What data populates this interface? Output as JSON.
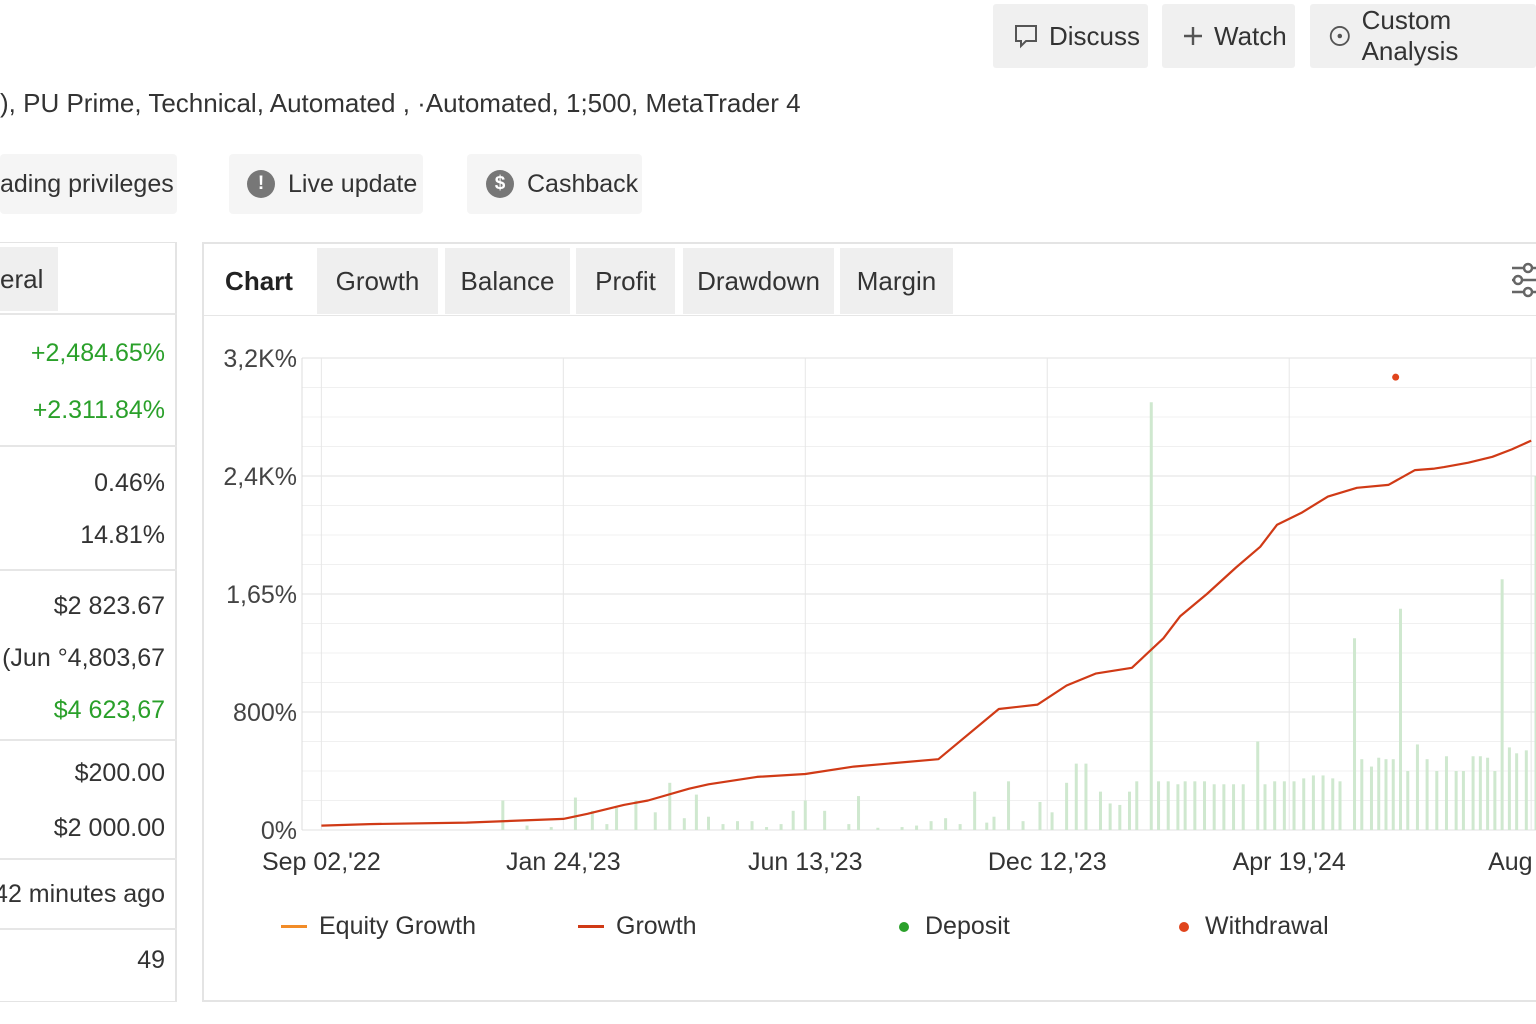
{
  "header": {
    "buttons": [
      {
        "label": "Discuss",
        "icon": "comment-icon"
      },
      {
        "label": "Watch",
        "icon": "plus-icon"
      },
      {
        "label": "Custom Analysis",
        "icon": "target-icon"
      }
    ],
    "meta": "), PU Prime, Technical, Automated , ·Automated, 1;500, MetaTrader 4"
  },
  "pills": {
    "privileges": "ading privileges",
    "live_update": "Live update",
    "live_update_icon": "!",
    "cashback": "Cashback",
    "cashback_icon": "$"
  },
  "stats": {
    "tab_label": "eral",
    "gain": "+2,484.65%",
    "abs_gain": "+2.311.84%",
    "daily": "0.46%",
    "drawdown": "14.81%",
    "balance": "$2 823.67",
    "equity": "(Jun °4,803,67",
    "profit": "$4 623,67",
    "deposits": "$200.00",
    "withdrawals": "$2 000.00",
    "updated": "42 minutes ago",
    "tracking": "49"
  },
  "tabs": [
    {
      "label": "Chart",
      "active": true
    },
    {
      "label": "Growth",
      "active": false
    },
    {
      "label": "Balance",
      "active": false
    },
    {
      "label": "Profit",
      "active": false
    },
    {
      "label": "Drawdown",
      "active": false
    },
    {
      "label": "Margin",
      "active": false
    }
  ],
  "colors": {
    "growth": "#d03a16",
    "equity": "#f28c28",
    "deposit": "#2aa02a",
    "withdrawal": "#e0441c",
    "bars": "#cfe8cf"
  },
  "chart_data": {
    "type": "line",
    "y_tick_labels": [
      "0%",
      "800%",
      "1,65%",
      "2,4K%",
      "3,2K%"
    ],
    "y_tick_values": [
      0,
      800,
      1600,
      2400,
      3200
    ],
    "x_tick_labels": [
      "Sep 02,'22",
      "Jan 24,'23",
      "Jun 13,'23",
      "Dec 12,'23",
      "Apr 19,'24",
      "Aug 05,"
    ],
    "x_range": [
      -0.08,
      5.02
    ],
    "ylim": [
      0,
      3200
    ],
    "grid": true,
    "series": [
      {
        "name": "Growth",
        "x": [
          0,
          0.2,
          0.6,
          1.0,
          1.1,
          1.25,
          1.35,
          1.52,
          1.6,
          1.8,
          2.0,
          2.2,
          2.55,
          2.8,
          2.96,
          3.08,
          3.2,
          3.35,
          3.48,
          3.55,
          3.66,
          3.78,
          3.88,
          3.95,
          4.05,
          4.16,
          4.28,
          4.41,
          4.52,
          4.6,
          4.64,
          4.74,
          4.84,
          4.92,
          5.0
        ],
        "y": [
          30,
          40,
          50,
          75,
          110,
          170,
          200,
          280,
          310,
          360,
          380,
          430,
          480,
          820,
          850,
          980,
          1060,
          1100,
          1300,
          1450,
          1600,
          1780,
          1920,
          2070,
          2150,
          2260,
          2320,
          2340,
          2440,
          2450,
          2460,
          2490,
          2530,
          2580,
          2640
        ]
      }
    ],
    "deposit_bars": [
      {
        "x": 0.75,
        "y": 200
      },
      {
        "x": 0.85,
        "y": 30
      },
      {
        "x": 0.95,
        "y": 20
      },
      {
        "x": 1.05,
        "y": 220
      },
      {
        "x": 1.12,
        "y": 130
      },
      {
        "x": 1.18,
        "y": 40
      },
      {
        "x": 1.22,
        "y": 150
      },
      {
        "x": 1.3,
        "y": 200
      },
      {
        "x": 1.38,
        "y": 120
      },
      {
        "x": 1.44,
        "y": 320
      },
      {
        "x": 1.5,
        "y": 80
      },
      {
        "x": 1.55,
        "y": 240
      },
      {
        "x": 1.6,
        "y": 90
      },
      {
        "x": 1.66,
        "y": 40
      },
      {
        "x": 1.72,
        "y": 60
      },
      {
        "x": 1.78,
        "y": 60
      },
      {
        "x": 1.84,
        "y": 20
      },
      {
        "x": 1.9,
        "y": 40
      },
      {
        "x": 1.95,
        "y": 130
      },
      {
        "x": 2.0,
        "y": 200
      },
      {
        "x": 2.08,
        "y": 130
      },
      {
        "x": 2.18,
        "y": 40
      },
      {
        "x": 2.22,
        "y": 230
      },
      {
        "x": 2.3,
        "y": 15
      },
      {
        "x": 2.4,
        "y": 20
      },
      {
        "x": 2.46,
        "y": 30
      },
      {
        "x": 2.52,
        "y": 60
      },
      {
        "x": 2.58,
        "y": 80
      },
      {
        "x": 2.64,
        "y": 40
      },
      {
        "x": 2.7,
        "y": 260
      },
      {
        "x": 2.75,
        "y": 50
      },
      {
        "x": 2.78,
        "y": 90
      },
      {
        "x": 2.84,
        "y": 330
      },
      {
        "x": 2.9,
        "y": 60
      },
      {
        "x": 2.97,
        "y": 190
      },
      {
        "x": 3.02,
        "y": 120
      },
      {
        "x": 3.08,
        "y": 320
      },
      {
        "x": 3.12,
        "y": 450
      },
      {
        "x": 3.16,
        "y": 450
      },
      {
        "x": 3.22,
        "y": 260
      },
      {
        "x": 3.26,
        "y": 180
      },
      {
        "x": 3.3,
        "y": 170
      },
      {
        "x": 3.34,
        "y": 260
      },
      {
        "x": 3.37,
        "y": 330
      },
      {
        "x": 3.43,
        "y": 2900
      },
      {
        "x": 3.46,
        "y": 330
      },
      {
        "x": 3.5,
        "y": 330
      },
      {
        "x": 3.54,
        "y": 310
      },
      {
        "x": 3.57,
        "y": 330
      },
      {
        "x": 3.61,
        "y": 330
      },
      {
        "x": 3.65,
        "y": 330
      },
      {
        "x": 3.69,
        "y": 310
      },
      {
        "x": 3.73,
        "y": 310
      },
      {
        "x": 3.77,
        "y": 310
      },
      {
        "x": 3.81,
        "y": 310
      },
      {
        "x": 3.87,
        "y": 600
      },
      {
        "x": 3.9,
        "y": 310
      },
      {
        "x": 3.94,
        "y": 330
      },
      {
        "x": 3.98,
        "y": 330
      },
      {
        "x": 4.02,
        "y": 330
      },
      {
        "x": 4.06,
        "y": 350
      },
      {
        "x": 4.1,
        "y": 370
      },
      {
        "x": 4.14,
        "y": 370
      },
      {
        "x": 4.18,
        "y": 350
      },
      {
        "x": 4.21,
        "y": 330
      },
      {
        "x": 4.27,
        "y": 1300
      },
      {
        "x": 4.3,
        "y": 480
      },
      {
        "x": 4.34,
        "y": 430
      },
      {
        "x": 4.37,
        "y": 490
      },
      {
        "x": 4.4,
        "y": 480
      },
      {
        "x": 4.43,
        "y": 480
      },
      {
        "x": 4.46,
        "y": 1500
      },
      {
        "x": 4.49,
        "y": 400
      },
      {
        "x": 4.53,
        "y": 580
      },
      {
        "x": 4.57,
        "y": 480
      },
      {
        "x": 4.61,
        "y": 400
      },
      {
        "x": 4.65,
        "y": 500
      },
      {
        "x": 4.69,
        "y": 400
      },
      {
        "x": 4.72,
        "y": 400
      },
      {
        "x": 4.76,
        "y": 500
      },
      {
        "x": 4.79,
        "y": 500
      },
      {
        "x": 4.82,
        "y": 490
      },
      {
        "x": 4.85,
        "y": 400
      },
      {
        "x": 4.88,
        "y": 1700
      },
      {
        "x": 4.91,
        "y": 560
      },
      {
        "x": 4.94,
        "y": 520
      },
      {
        "x": 4.98,
        "y": 540
      },
      {
        "x": 5.02,
        "y": 2400
      },
      {
        "x": 5.05,
        "y": 560
      },
      {
        "x": 5.08,
        "y": 580
      },
      {
        "x": 5.12,
        "y": 640
      },
      {
        "x": 5.15,
        "y": 660
      },
      {
        "x": 5.18,
        "y": 720
      },
      {
        "x": 5.22,
        "y": 2200
      },
      {
        "x": 5.25,
        "y": 780
      },
      {
        "x": 5.28,
        "y": 2500
      },
      {
        "x": 5.31,
        "y": 1100
      },
      {
        "x": 5.35,
        "y": 560
      },
      {
        "x": 5.39,
        "y": 500
      },
      {
        "x": 5.42,
        "y": 900
      }
    ],
    "withdrawal_points": [
      {
        "x": 4.44,
        "y": 3070
      }
    ],
    "legend": [
      "Equity Growth",
      "Growth",
      "Deposit",
      "Withdrawal"
    ]
  }
}
